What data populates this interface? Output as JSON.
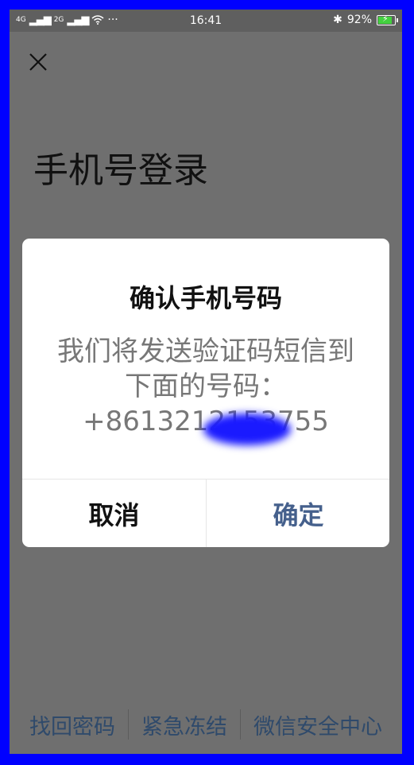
{
  "status_bar": {
    "network_1": "4G",
    "network_2": "2G",
    "more": "···",
    "time": "16:41",
    "battery": "92%"
  },
  "page": {
    "title": "手机号登录"
  },
  "dialog": {
    "title": "确认手机号码",
    "message_line1": "我们将发送验证码短信到",
    "message_line2": "下面的号码：",
    "phone_number": "+8613212153755",
    "cancel_label": "取消",
    "confirm_label": "确定"
  },
  "bottom_links": [
    {
      "label": "找回密码"
    },
    {
      "label": "紧急冻结"
    },
    {
      "label": "微信安全中心"
    }
  ],
  "colors": {
    "frame": "#0000ff",
    "overlay": "#6f6f6f",
    "confirm": "#45608c",
    "link": "#2f4a6b"
  }
}
